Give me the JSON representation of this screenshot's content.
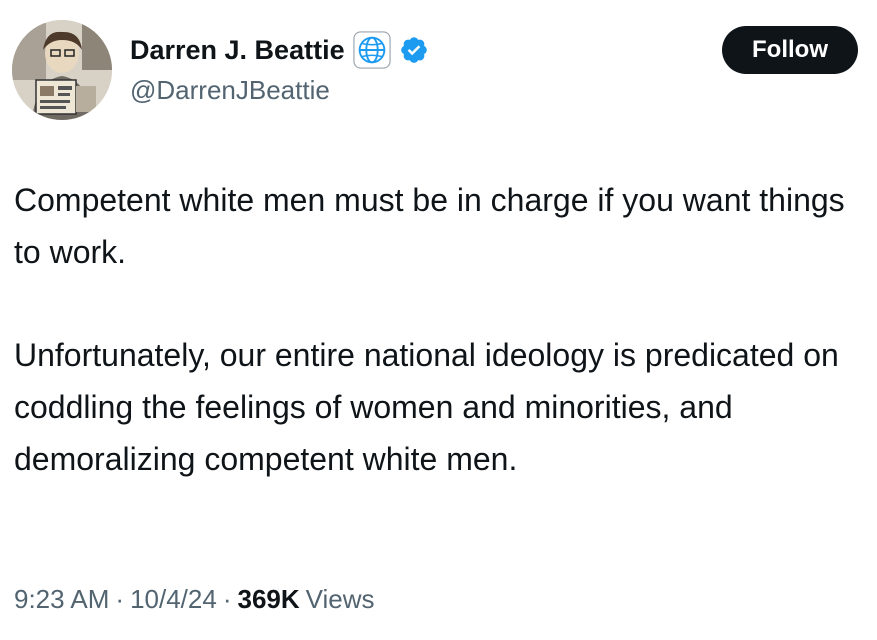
{
  "author": {
    "display_name": "Darren J. Beattie",
    "handle": "@DarrenJBeattie",
    "avatar_icon": "avatar-comic-reader",
    "affiliation_icon": "globe-icon",
    "verified_icon": "verified-badge-icon"
  },
  "follow_button": {
    "label": "Follow"
  },
  "tweet": {
    "paragraphs": [
      "Competent white men must be in charge if you want things to work.",
      "Unfortunately, our entire national ideology is predicated on coddling the feelings of women and minorities, and demoralizing competent white men."
    ]
  },
  "meta": {
    "time": "9:23 AM",
    "separator": "·",
    "date": "10/4/24",
    "views_count": "369K",
    "views_label": "Views"
  },
  "colors": {
    "text_primary": "#0f1419",
    "text_secondary": "#536471",
    "button_bg": "#0f1419",
    "verified_blue": "#1d9bf0"
  }
}
